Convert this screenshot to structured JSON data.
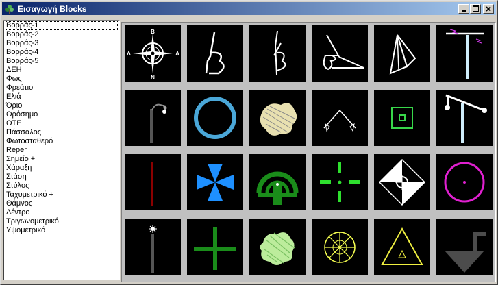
{
  "window": {
    "title": "Εισαγωγή Blocks"
  },
  "list": {
    "items": [
      "Βορράς-1",
      "Βορράς-2",
      "Βορράς-3",
      "Βορράς-4",
      "Βορράς-5",
      "ΔΕΗ",
      "Φως",
      "Φρεάτιο",
      "Ελιά",
      "Όριο",
      "Ορόσημο",
      "ΟΤΕ",
      "Πάσσαλος",
      "Φωτοσταθερό",
      "Reper",
      "Σημείο +",
      "Χάραξη",
      "Στάση",
      "Στύλος",
      "Ταχυμετρικό +",
      "Θάμνος",
      "Δέντρο",
      "Τριγωνομετρικό",
      "Υψομετρικό"
    ]
  },
  "compass": {
    "n": "N",
    "s": "B",
    "e": "A",
    "w": "Δ"
  },
  "blocks": [
    "north-compass",
    "north-arrow-b-1",
    "north-arrow-b-2",
    "north-arrow-b-script",
    "north-arrow-kite",
    "power-pole",
    "street-light",
    "manhole",
    "olive-tree",
    "boundary-point",
    "landmark",
    "telephone-pole",
    "stake",
    "photo-control-point",
    "reference-point",
    "point-cross",
    "alignment-point",
    "bus-stop",
    "column",
    "tacheometric-cross",
    "shrub",
    "tree",
    "trigonometric-point",
    "elevation-point"
  ],
  "colors": {
    "title_start": "#0a246a",
    "title_end": "#a6caf0",
    "tile_bg": "#000000",
    "panel": "#c0c0c0",
    "window": "#d4d0c8"
  }
}
